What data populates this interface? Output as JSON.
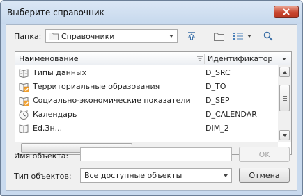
{
  "window": {
    "title": "Выберите справочник"
  },
  "toolbar": {
    "folder_label": "Папка:",
    "folder_value": "Справочники"
  },
  "list": {
    "columns": [
      "Наименование",
      "Идентификатор"
    ],
    "rows": [
      {
        "name": "Типы данных",
        "id": "D_SRC",
        "icon": "book-icon"
      },
      {
        "name": "Территориальные образования",
        "id": "D_TO",
        "icon": "book-check-icon"
      },
      {
        "name": "Социально-экономические показатели",
        "id": "D_SEP",
        "icon": "book-check-icon"
      },
      {
        "name": "Календарь",
        "id": "D_CALENDAR",
        "icon": "calendar-icon"
      },
      {
        "name": "Ed.Зн...",
        "id": "DIM_2",
        "icon": "book-icon"
      }
    ]
  },
  "form": {
    "object_name_label": "Имя объекта:",
    "object_name_value": "",
    "object_type_label": "Тип объектов:",
    "object_type_value": "Все доступные объекты",
    "ok_label": "OK",
    "cancel_label": "Отмена"
  }
}
